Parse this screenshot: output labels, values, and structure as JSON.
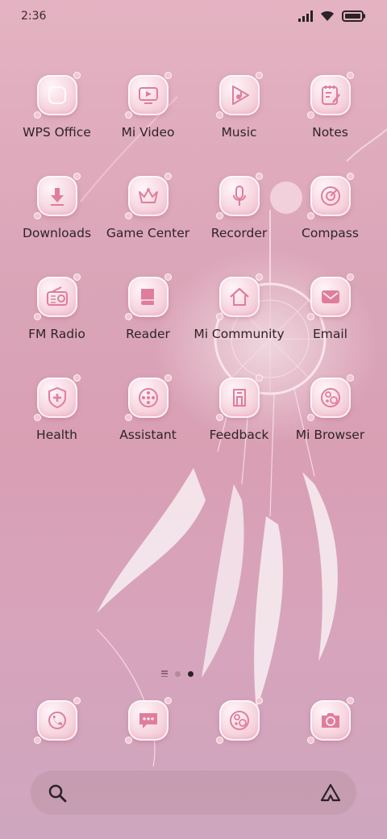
{
  "status_bar": {
    "time": "2:36",
    "icons": [
      "signal-icon",
      "wifi-icon",
      "battery-icon"
    ]
  },
  "apps": [
    [
      {
        "label": "WPS Office",
        "icon": "wps-office-icon"
      },
      {
        "label": "Mi Video",
        "icon": "video-icon"
      },
      {
        "label": "Music",
        "icon": "music-icon"
      },
      {
        "label": "Notes",
        "icon": "notes-icon"
      }
    ],
    [
      {
        "label": "Downloads",
        "icon": "download-icon"
      },
      {
        "label": "Game Center",
        "icon": "crown-icon"
      },
      {
        "label": "Recorder",
        "icon": "microphone-icon"
      },
      {
        "label": "Compass",
        "icon": "compass-icon"
      }
    ],
    [
      {
        "label": "FM Radio",
        "icon": "radio-icon"
      },
      {
        "label": "Reader",
        "icon": "book-icon"
      },
      {
        "label": "Mi Community",
        "icon": "home-icon"
      },
      {
        "label": "Email",
        "icon": "mail-icon"
      }
    ],
    [
      {
        "label": "Health",
        "icon": "shield-plus-icon"
      },
      {
        "label": "Assistant",
        "icon": "assistant-icon"
      },
      {
        "label": "Feedback",
        "icon": "feedback-icon"
      },
      {
        "label": "Mi Browser",
        "icon": "browser-icon"
      }
    ]
  ],
  "pager": {
    "pages": 2,
    "current": 2
  },
  "dock": [
    {
      "icon": "phone-icon"
    },
    {
      "icon": "messages-icon"
    },
    {
      "icon": "browser-icon"
    },
    {
      "icon": "camera-icon"
    }
  ],
  "search": {
    "icon": "search-icon",
    "assistant_icon": "assistant-triangle-icon"
  },
  "colors": {
    "background": "#dba6b9",
    "icon_tile": "#f7d6e0",
    "icon_glyph": "#e07d9c",
    "label": "#2f2428"
  }
}
